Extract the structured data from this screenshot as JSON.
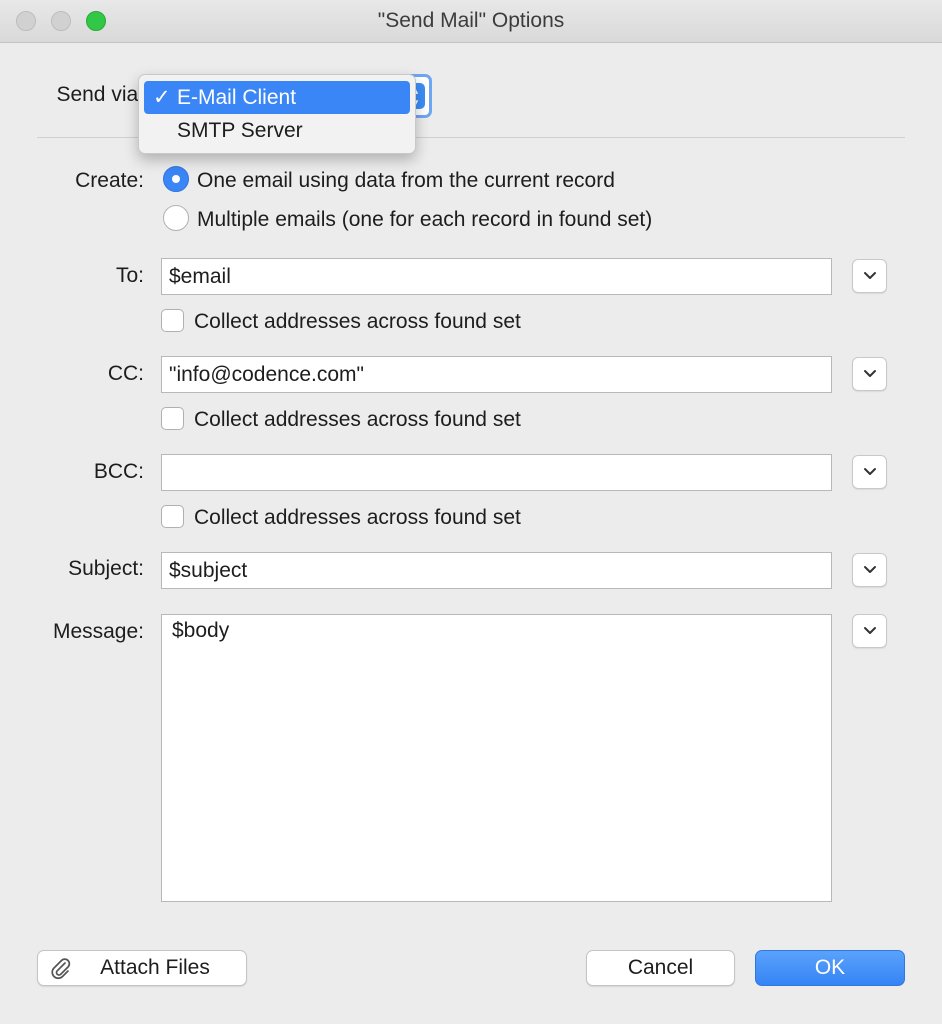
{
  "window": {
    "title": "\"Send Mail\" Options"
  },
  "send_via": {
    "label": "Send via:",
    "options": [
      {
        "label": "E-Mail Client",
        "selected": true
      },
      {
        "label": "SMTP Server",
        "selected": false
      }
    ],
    "check_glyph": "✓"
  },
  "create": {
    "label": "Create:",
    "options": [
      {
        "label": "One email using data from the current record",
        "selected": true
      },
      {
        "label": "Multiple emails (one for each record in found set)",
        "selected": false
      }
    ]
  },
  "to": {
    "label": "To:",
    "value": "$email",
    "collect_label": "Collect addresses across found set",
    "collect_checked": false
  },
  "cc": {
    "label": "CC:",
    "value": "\"info@codence.com\"",
    "collect_label": "Collect addresses across found set",
    "collect_checked": false
  },
  "bcc": {
    "label": "BCC:",
    "value": "",
    "collect_label": "Collect addresses across found set",
    "collect_checked": false
  },
  "subject": {
    "label": "Subject:",
    "value": "$subject"
  },
  "message": {
    "label": "Message:",
    "value": "$body"
  },
  "buttons": {
    "attach": "Attach Files",
    "cancel": "Cancel",
    "ok": "OK"
  },
  "colors": {
    "accent": "#3b86f6",
    "close_inactive": "#d1d1d1",
    "zoom": "#33c748"
  },
  "icons": {
    "dropdown": "chevron-down-icon",
    "attach": "paperclip-icon",
    "check": "checkmark-icon"
  }
}
